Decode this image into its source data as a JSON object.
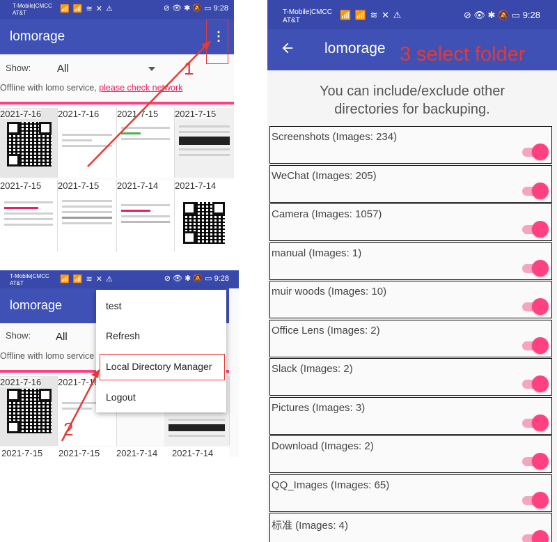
{
  "colors": {
    "appbar": "#3f51b5",
    "statusbar": "#3949ab",
    "accent": "#ff4081",
    "annotation": "#e53935"
  },
  "status_bar": {
    "carrier": "T-Mobile|CMCC",
    "carrier2": "AT&T",
    "net_icons": "📶 📶 ≋ ✕ ⚠",
    "right_icons": "⊘ 👁 ✱ 🔕",
    "time": "9:28"
  },
  "screen1": {
    "app_title": "lomorage",
    "show_label": "Show:",
    "show_value": "All",
    "offline_text": "Offline with lomo service, ",
    "offline_link": "please check network",
    "thumbnails": [
      {
        "date": "2021-7-16"
      },
      {
        "date": "2021-7-16"
      },
      {
        "date": "2021-7-15"
      },
      {
        "date": "2021-7-15"
      },
      {
        "date": "2021-7-15"
      },
      {
        "date": "2021-7-15"
      },
      {
        "date": "2021-7-14"
      },
      {
        "date": "2021-7-14"
      }
    ],
    "annotation": "1"
  },
  "screen2": {
    "app_title": "lomorage",
    "show_label": "Show:",
    "show_value": "All",
    "offline_text": "Offline with lomo service",
    "menu": [
      "test",
      "Refresh",
      "Local Directory Manager",
      "Logout"
    ],
    "thumbnails": [
      {
        "date": "2021-7-16"
      },
      {
        "date": "2021-7-16"
      },
      {
        "date": "2021-7-15"
      },
      {
        "date": "2021-7-15"
      },
      {
        "date": "2021-7-14"
      },
      {
        "date": "2021-7-14"
      }
    ],
    "annotation": "2"
  },
  "screen3": {
    "app_title": "lomorage",
    "annotation": "3 select folder",
    "description": "You can include/exclude other directories for backuping.",
    "folders": [
      {
        "label": "Screenshots (Images: 234)",
        "enabled": true
      },
      {
        "label": "WeChat (Images: 205)",
        "enabled": true
      },
      {
        "label": "Camera (Images: 1057)",
        "enabled": true
      },
      {
        "label": "manual (Images: 1)",
        "enabled": true
      },
      {
        "label": "muir woods (Images: 10)",
        "enabled": true
      },
      {
        "label": "Office Lens (Images: 2)",
        "enabled": true
      },
      {
        "label": "Slack (Images: 2)",
        "enabled": true
      },
      {
        "label": "Pictures (Images: 3)",
        "enabled": true
      },
      {
        "label": "Download (Images: 2)",
        "enabled": true
      },
      {
        "label": "QQ_Images (Images: 65)",
        "enabled": true
      },
      {
        "label": "标准 (Images: 4)",
        "enabled": true
      }
    ]
  }
}
